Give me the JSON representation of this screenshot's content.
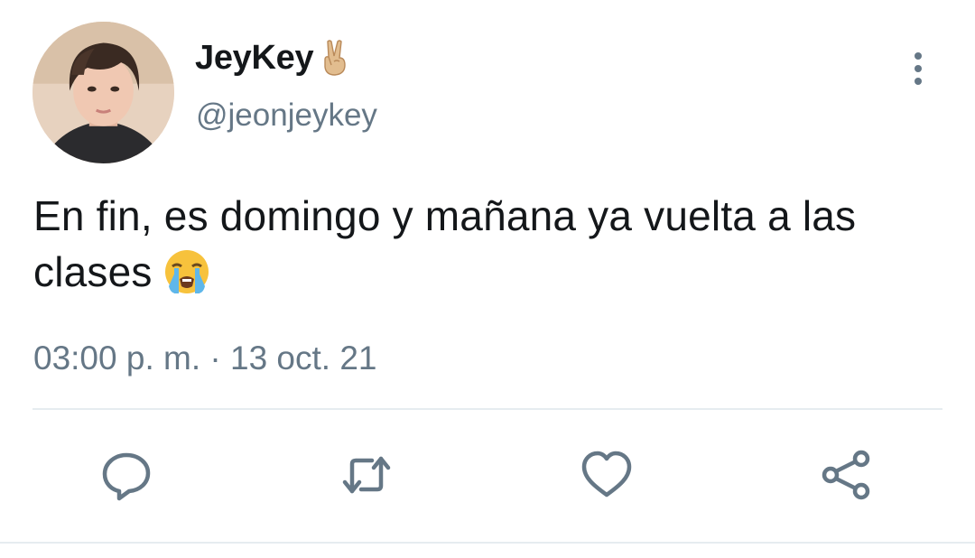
{
  "tweet": {
    "display_name": "JeyKey",
    "name_emoji": "victory-hand-emoji",
    "handle": "@jeonjeykey",
    "text": "En fin, es domingo y mañana ya vuelta a las clases",
    "text_emoji": "loudly-crying-face-emoji",
    "timestamp": "03:00 p. m. · 13 oct. 21"
  },
  "actions": {
    "reply_icon": "reply-icon",
    "retweet_icon": "retweet-icon",
    "like_icon": "heart-icon",
    "share_icon": "share-icon",
    "more_icon": "more-vertical-icon"
  },
  "colors": {
    "text": "#14171a",
    "secondary": "#657786",
    "divider": "#e6ecf0",
    "icon": "#657786"
  }
}
